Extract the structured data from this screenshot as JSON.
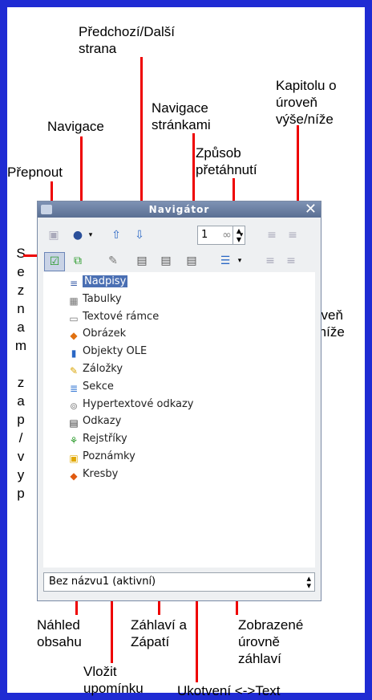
{
  "annotations": {
    "predchozi_dalsi": "Předchozí/Další\nstrana",
    "kapitolu": "Kapitolu o\núroveň\nvýše/níže",
    "navigace_strankami": "Navigace\nstránkami",
    "navigace": "Navigace",
    "zpusob": "Způsob\npřetáhnutí",
    "prepnout": "Přepnout",
    "seznam": [
      "S",
      "e",
      "z",
      "n",
      "a",
      "m",
      "",
      "z",
      "a",
      "p",
      "/",
      "v",
      "y",
      "p"
    ],
    "o_uroven": "O úroveň\nvýše/níže",
    "nahled": "Náhled\nobsahu",
    "zahlavi": "Záhlaví a\nZápatí",
    "zobrazene": "Zobrazené\núrovně\nzáhlaví",
    "vlozit": "Vložit\nupomínku",
    "ukotveni": "Ukotvení <->Text"
  },
  "navigator": {
    "title": "Navigátor",
    "page_number": "1",
    "items": [
      {
        "label": "Nadpisy",
        "icon": "headings-icon",
        "glyph": "≡",
        "color": "#3b5ea8"
      },
      {
        "label": "Tabulky",
        "icon": "tables-icon",
        "glyph": "▦",
        "color": "#777"
      },
      {
        "label": "Textové rámce",
        "icon": "text-frames-icon",
        "glyph": "▭",
        "color": "#777"
      },
      {
        "label": "Obrázek",
        "icon": "image-icon",
        "glyph": "◆",
        "color": "#e07010"
      },
      {
        "label": "Objekty OLE",
        "icon": "ole-objects-icon",
        "glyph": "▮",
        "color": "#2a67c5"
      },
      {
        "label": "Záložky",
        "icon": "bookmarks-icon",
        "glyph": "✎",
        "color": "#d9a300"
      },
      {
        "label": "Sekce",
        "icon": "sections-icon",
        "glyph": "≣",
        "color": "#3a7bd5"
      },
      {
        "label": "Hypertextové odkazy",
        "icon": "hyperlinks-icon",
        "glyph": "⊚",
        "color": "#888"
      },
      {
        "label": "Odkazy",
        "icon": "references-icon",
        "glyph": "▤",
        "color": "#333"
      },
      {
        "label": "Rejstříky",
        "icon": "indexes-icon",
        "glyph": "⚘",
        "color": "#2a9a2a"
      },
      {
        "label": "Poznámky",
        "icon": "comments-icon",
        "glyph": "▣",
        "color": "#e0a800"
      },
      {
        "label": "Kresby",
        "icon": "drawings-icon",
        "glyph": "◆",
        "color": "#e05a10"
      }
    ],
    "document": "Bez názvu1 (aktivní)"
  },
  "colors": {
    "frame": "#1f2bd3",
    "callout": "#ee0000"
  }
}
